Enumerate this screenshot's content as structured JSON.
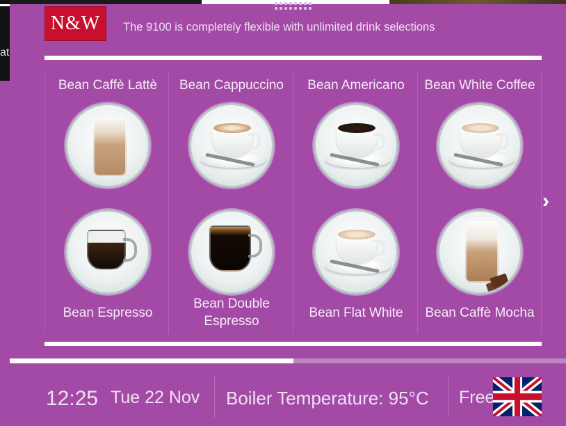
{
  "background": {
    "left_text": "at"
  },
  "header": {
    "brand": "N&W",
    "tagline": "The 9100 is completely flexible with unlimited drink selections"
  },
  "drinks": [
    {
      "label": "Bean Caffè Lattè",
      "icon": "latte-glass-icon"
    },
    {
      "label": "Bean Cappuccino",
      "icon": "cappuccino-cup-icon"
    },
    {
      "label": "Bean Americano",
      "icon": "americano-cup-icon"
    },
    {
      "label": "Bean White Coffee",
      "icon": "white-coffee-cup-icon"
    },
    {
      "label": "Bean Espresso",
      "icon": "espresso-glass-cup-icon"
    },
    {
      "label": "Bean Double Espresso",
      "icon": "double-espresso-glass-cup-icon"
    },
    {
      "label": "Bean Flat White",
      "icon": "flat-white-cup-icon"
    },
    {
      "label": "Bean Caffè Mocha",
      "icon": "mocha-glass-icon"
    }
  ],
  "navigation": {
    "next_arrow": "›"
  },
  "page_progress": 0.51,
  "status": {
    "time": "12:25",
    "date": "Tue 22 Nov",
    "boiler": "Boiler Temperature: 95°C",
    "free": "Free",
    "language_flag": "uk-flag-icon"
  },
  "colors": {
    "background": "#a24aa6",
    "brand_red": "#c8102e",
    "rule": "#ffffff"
  }
}
